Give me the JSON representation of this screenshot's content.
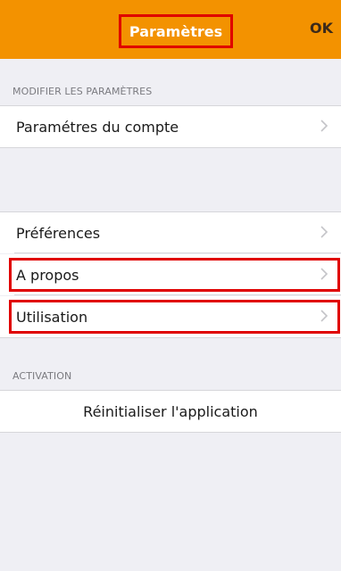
{
  "navbar": {
    "title": "Paramètres",
    "ok_label": "OK"
  },
  "sections": {
    "modify_header": "MODIFIER LES PARAMÈTRES",
    "activation_header": "ACTIVATION"
  },
  "rows": {
    "account_settings": "Paramétres du compte",
    "preferences": "Préférences",
    "about": "A propos",
    "usage": "Utilisation",
    "reset_app": "Réinitialiser l'application"
  },
  "colors": {
    "navbar_bg": "#f39200",
    "highlight": "#e00000",
    "background": "#efeff4"
  }
}
